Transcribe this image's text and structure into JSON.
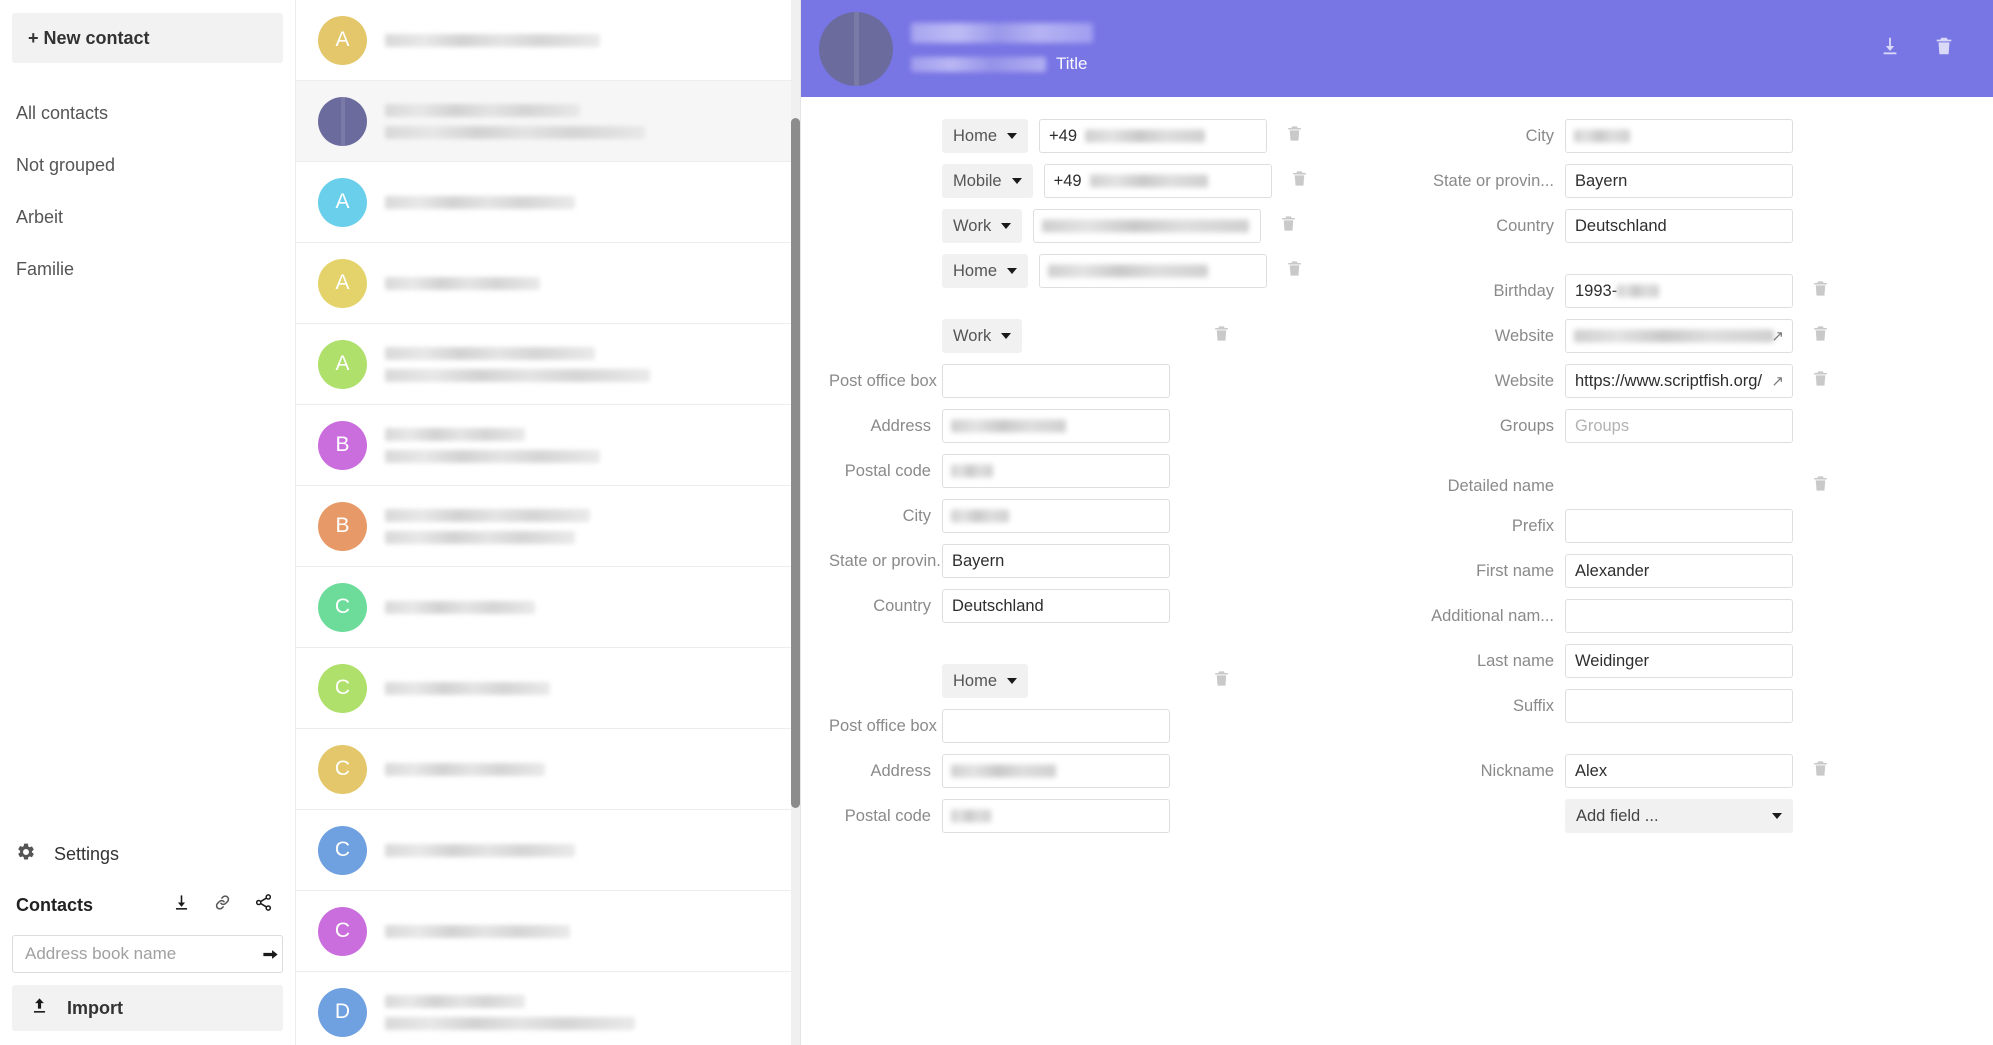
{
  "sidebar": {
    "new_contact_label": "+ New contact",
    "nav_items": [
      {
        "label": "All contacts"
      },
      {
        "label": "Not grouped"
      },
      {
        "label": "Arbeit"
      },
      {
        "label": "Familie"
      }
    ],
    "settings_label": "Settings",
    "contacts_label": "Contacts",
    "addressbook_placeholder": "Address book name",
    "addressbook_value": "",
    "import_label": "Import"
  },
  "contact_list": [
    {
      "initial": "A",
      "color": "#e3c76a",
      "lines": 1,
      "selected": false,
      "photo": false
    },
    {
      "initial": "",
      "color": "#6b6b9e",
      "lines": 2,
      "selected": true,
      "photo": true
    },
    {
      "initial": "A",
      "color": "#69cfea",
      "lines": 1,
      "selected": false,
      "photo": false
    },
    {
      "initial": "A",
      "color": "#e3d36a",
      "lines": 1,
      "selected": false,
      "photo": false
    },
    {
      "initial": "A",
      "color": "#aee06b",
      "lines": 2,
      "selected": false,
      "photo": false
    },
    {
      "initial": "B",
      "color": "#cb6edd",
      "lines": 2,
      "selected": false,
      "photo": false
    },
    {
      "initial": "B",
      "color": "#e79a67",
      "lines": 2,
      "selected": false,
      "photo": false
    },
    {
      "initial": "C",
      "color": "#6ddc9b",
      "lines": 1,
      "selected": false,
      "photo": false
    },
    {
      "initial": "C",
      "color": "#aee06b",
      "lines": 1,
      "selected": false,
      "photo": false
    },
    {
      "initial": "C",
      "color": "#e3c76a",
      "lines": 1,
      "selected": false,
      "photo": false
    },
    {
      "initial": "C",
      "color": "#6fa0e0",
      "lines": 1,
      "selected": false,
      "photo": false
    },
    {
      "initial": "C",
      "color": "#cb6edd",
      "lines": 1,
      "selected": false,
      "photo": false
    },
    {
      "initial": "D",
      "color": "#6fa0e0",
      "lines": 2,
      "selected": false,
      "photo": false
    }
  ],
  "detail_header": {
    "title_placeholder": "Title",
    "accent_color": "#7875e5",
    "download_icon": "download-icon",
    "delete_icon": "trash-icon"
  },
  "phones": [
    {
      "type": "Home",
      "value_prefix": "+49",
      "blurred": true,
      "blur_width": 120
    },
    {
      "type": "Mobile",
      "value_prefix": "+49",
      "blurred": true,
      "blur_width": 118
    },
    {
      "type": "Work",
      "value_prefix": "",
      "blurred": true,
      "blur_width": 207
    },
    {
      "type": "Home",
      "value_prefix": "",
      "blurred": true,
      "blur_width": 160
    }
  ],
  "address_blocks": [
    {
      "type": "Work",
      "fields": [
        {
          "label": "Post office box",
          "value": "",
          "blurred": false,
          "blur_width": 0
        },
        {
          "label": "Address",
          "value": "",
          "blurred": true,
          "blur_width": 115
        },
        {
          "label": "Postal code",
          "value": "",
          "blurred": true,
          "blur_width": 42
        },
        {
          "label": "City",
          "value": "",
          "blurred": true,
          "blur_width": 58
        },
        {
          "label": "State or provin...",
          "value": "Bayern",
          "blurred": false,
          "blur_width": 0
        },
        {
          "label": "Country",
          "value": "Deutschland",
          "blurred": false,
          "blur_width": 0
        }
      ]
    },
    {
      "type": "Home",
      "fields": [
        {
          "label": "Post office box",
          "value": "",
          "blurred": false,
          "blur_width": 0
        },
        {
          "label": "Address",
          "value": "",
          "blurred": true,
          "blur_width": 105
        },
        {
          "label": "Postal code",
          "value": "",
          "blurred": true,
          "blur_width": 40
        }
      ]
    }
  ],
  "right_column": {
    "address_top": [
      {
        "label": "City",
        "value": "",
        "blurred": true,
        "blur_width": 56
      },
      {
        "label": "State or provin...",
        "value": "Bayern",
        "blurred": false,
        "blur_width": 0
      },
      {
        "label": "Country",
        "value": "Deutschland",
        "blurred": false,
        "blur_width": 0
      }
    ],
    "birthday": {
      "label": "Birthday",
      "value": "1993-",
      "blurred": true,
      "blur_width": 42
    },
    "websites": [
      {
        "label": "Website",
        "value": "",
        "blurred": true,
        "blur_width": 200
      },
      {
        "label": "Website",
        "value": "https://www.scriptfish.org/",
        "blurred": false,
        "blur_width": 0
      }
    ],
    "groups": {
      "label": "Groups",
      "value": "",
      "placeholder": "Groups"
    },
    "detailed_name_label": "Detailed name",
    "name_fields": [
      {
        "label": "Prefix",
        "value": ""
      },
      {
        "label": "First name",
        "value": "Alexander"
      },
      {
        "label": "Additional nam...",
        "value": ""
      },
      {
        "label": "Last name",
        "value": "Weidinger"
      },
      {
        "label": "Suffix",
        "value": ""
      }
    ],
    "nickname": {
      "label": "Nickname",
      "value": "Alex"
    },
    "add_field_label": "Add field ..."
  }
}
